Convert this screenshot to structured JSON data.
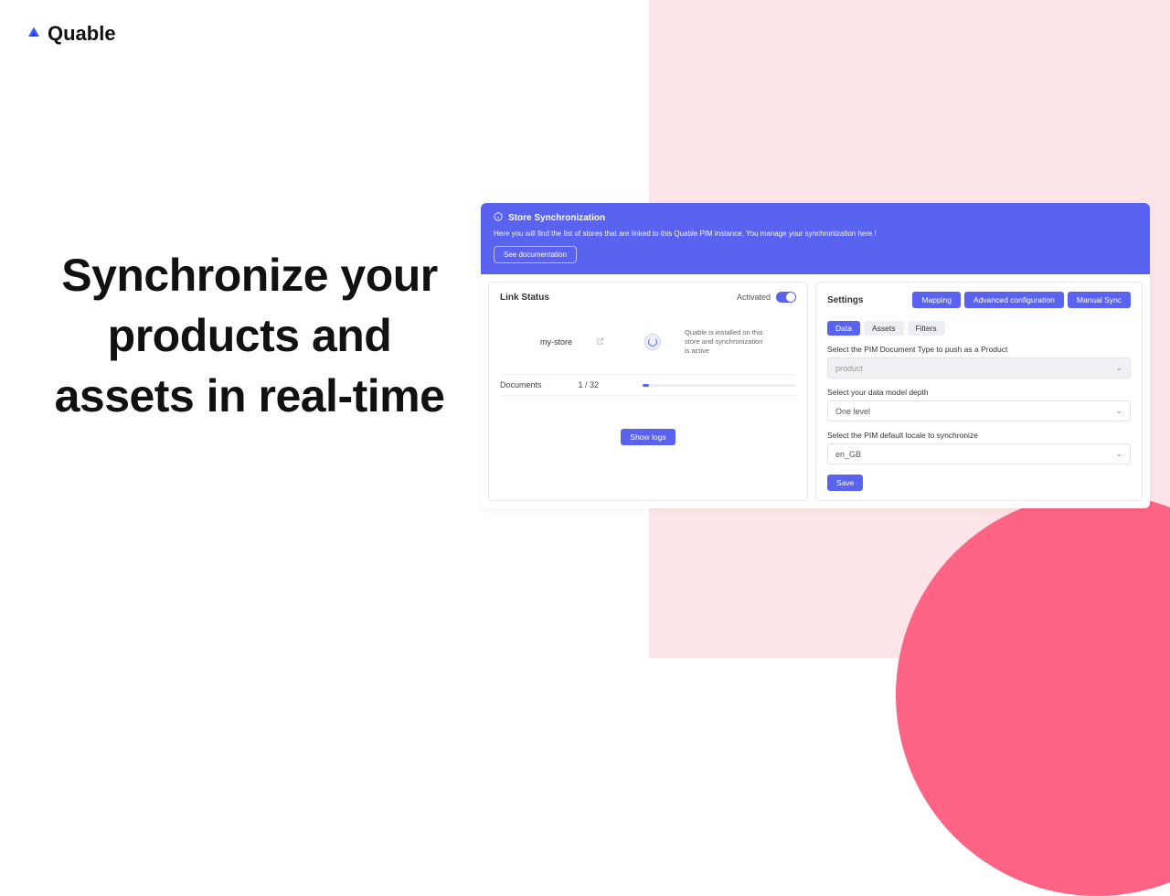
{
  "brand": {
    "name": "Quable"
  },
  "headline": "Synchronize your products and assets in real-time",
  "banner": {
    "title": "Store Synchronization",
    "desc": "Here you will find the list of stores that are linked to this Quable PIM instance. You manage your synchronization here !",
    "doc_btn": "See documentation"
  },
  "link": {
    "title": "Link Status",
    "activated_label": "Activated",
    "store_name": "my-store",
    "status_text": "Quable is installed on this store and synchronization is active",
    "documents_label": "Documents",
    "documents_count": "1 / 32",
    "show_logs": "Show logs"
  },
  "settings": {
    "title": "Settings",
    "buttons": {
      "mapping": "Mapping",
      "advanced": "Advanced configuration",
      "manual": "Manual Sync"
    },
    "tabs": {
      "data": "Data",
      "assets": "Assets",
      "filters": "Filters"
    },
    "field1": {
      "label": "Select the PIM Document Type to push as a Product",
      "value": "product"
    },
    "field2": {
      "label": "Select your data model depth",
      "value": "One level"
    },
    "field3": {
      "label": "Select the PIM default locale to synchronize",
      "value": "en_GB"
    },
    "save": "Save"
  }
}
